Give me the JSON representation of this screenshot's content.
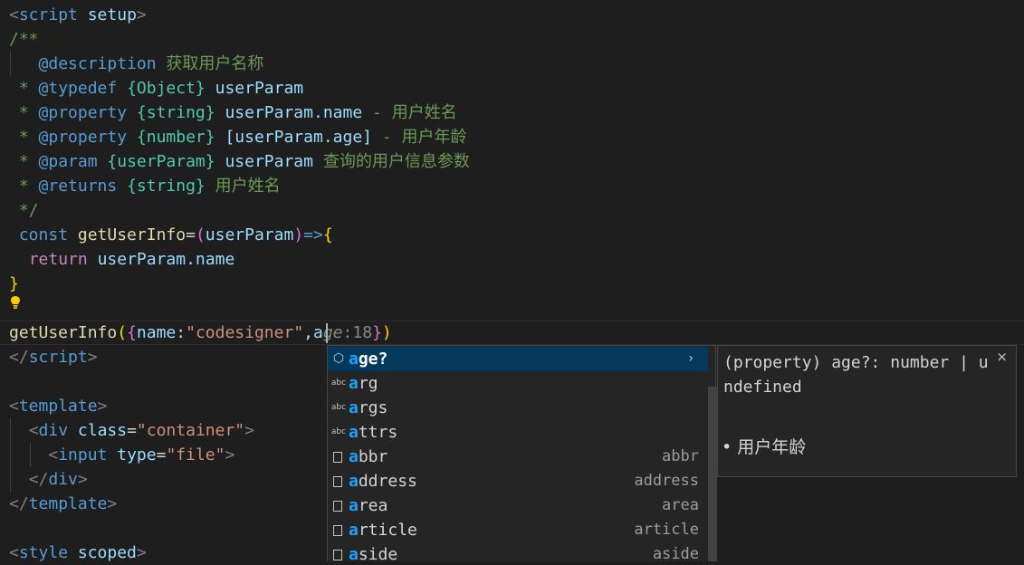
{
  "code": {
    "script_open": {
      "lt": "<",
      "name": "script",
      "attr": "setup",
      "gt": ">"
    },
    "doc_open": "/**",
    "description": {
      "tag": "@description",
      "text": "获取用户名称"
    },
    "typedef": {
      "star": " * ",
      "tag": "@typedef",
      "type": "{Object}",
      "name": "userParam"
    },
    "prop1": {
      "star": " * ",
      "tag": "@property",
      "type": "{string}",
      "name": "userParam.name",
      "text": "- 用户姓名"
    },
    "prop2": {
      "star": " * ",
      "tag": "@property",
      "type": "{number}",
      "name": "[userParam.age]",
      "text": "- 用户年龄"
    },
    "param": {
      "star": " * ",
      "tag": "@param",
      "type": "{userParam}",
      "name": "userParam",
      "text": "查询的用户信息参数"
    },
    "returns": {
      "star": " * ",
      "tag": "@returns",
      "type": "{string}",
      "text": "用户姓名"
    },
    "doc_close": " */",
    "const_line": {
      "kw": "const",
      "fn": "getUserInfo",
      "eq": "=",
      "lp": "(",
      "arg": "userParam",
      "rp": ")",
      "arrow": "=>",
      "lb": "{"
    },
    "return_line": {
      "kw": "return",
      "expr": "userParam.name"
    },
    "close_brace": "}",
    "call_line": {
      "fn": "getUserInfo",
      "lp": "(",
      "lb": "{",
      "key": "name",
      "colon": ":",
      "str": "\"codesigner\"",
      "comma": ",",
      "typed": "a",
      "hint_rest": "ge",
      "hint_colon": ":",
      "hint_val": "18",
      "rb": "}",
      "rp": ")"
    },
    "script_close": {
      "lt": "</",
      "name": "script",
      "gt": ">"
    },
    "template_open": {
      "lt": "<",
      "name": "template",
      "gt": ">"
    },
    "div_line": {
      "lt": "<",
      "name": "div",
      "attr": "class",
      "eq": "=",
      "val": "\"container\"",
      "gt": ">"
    },
    "input_line": {
      "lt": "<",
      "name": "input",
      "attr": "type",
      "eq": "=",
      "val": "\"file\"",
      "gt": ">"
    },
    "div_close": {
      "lt": "</",
      "name": "div",
      "gt": ">"
    },
    "template_close": {
      "lt": "</",
      "name": "template",
      "gt": ">"
    },
    "style_open": {
      "lt": "<",
      "name": "style",
      "attr": "scoped",
      "gt": ">"
    }
  },
  "suggest": {
    "items": [
      {
        "match": "a",
        "rest": "ge?",
        "detail": "",
        "icon": "property-icon",
        "icon_glyph": "⬡"
      },
      {
        "match": "a",
        "rest": "rg",
        "detail": "",
        "icon": "text-word-icon",
        "icon_glyph": "abc"
      },
      {
        "match": "a",
        "rest": "rgs",
        "detail": "",
        "icon": "text-word-icon",
        "icon_glyph": "abc"
      },
      {
        "match": "a",
        "rest": "ttrs",
        "detail": "",
        "icon": "text-word-icon",
        "icon_glyph": "abc"
      },
      {
        "match": "a",
        "rest": "bbr",
        "detail": "abbr",
        "icon": "snippet-box-icon",
        "icon_glyph": ""
      },
      {
        "match": "a",
        "rest": "ddress",
        "detail": "address",
        "icon": "snippet-box-icon",
        "icon_glyph": ""
      },
      {
        "match": "a",
        "rest": "rea",
        "detail": "area",
        "icon": "snippet-box-icon",
        "icon_glyph": ""
      },
      {
        "match": "a",
        "rest": "rticle",
        "detail": "article",
        "icon": "snippet-box-icon",
        "icon_glyph": ""
      },
      {
        "match": "a",
        "rest": "side",
        "detail": "aside",
        "icon": "snippet-box-icon",
        "icon_glyph": ""
      }
    ],
    "more_glyph": "›"
  },
  "details": {
    "signature": "(property) age?: number | undefined",
    "close_glyph": "×",
    "doc_bullet": "•",
    "doc_text": "用户年龄"
  }
}
